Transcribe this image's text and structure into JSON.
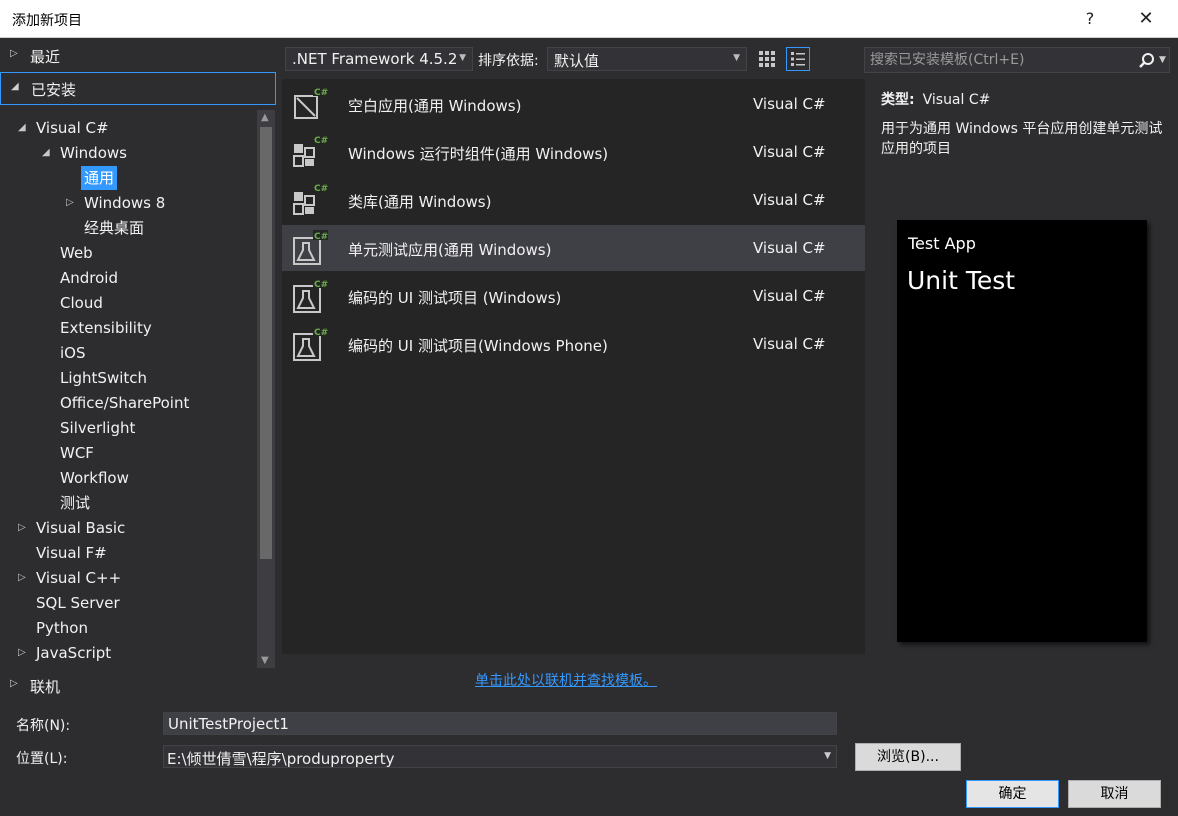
{
  "window": {
    "title": "添加新项目",
    "help": "?",
    "close": "✕"
  },
  "sections": {
    "recent": "最近",
    "installed": "已安装",
    "online": "联机"
  },
  "tree": [
    {
      "label": "Visual C#",
      "level": 0,
      "arrow": "down"
    },
    {
      "label": "Windows",
      "level": 1,
      "arrow": "down"
    },
    {
      "label": "通用",
      "level": 2,
      "arrow": "none",
      "selected": true
    },
    {
      "label": "Windows 8",
      "level": 2,
      "arrow": "right"
    },
    {
      "label": "经典桌面",
      "level": 2,
      "arrow": "none"
    },
    {
      "label": "Web",
      "level": 1,
      "arrow": "none"
    },
    {
      "label": "Android",
      "level": 1,
      "arrow": "none"
    },
    {
      "label": "Cloud",
      "level": 1,
      "arrow": "none"
    },
    {
      "label": "Extensibility",
      "level": 1,
      "arrow": "none"
    },
    {
      "label": "iOS",
      "level": 1,
      "arrow": "none"
    },
    {
      "label": "LightSwitch",
      "level": 1,
      "arrow": "none"
    },
    {
      "label": "Office/SharePoint",
      "level": 1,
      "arrow": "none"
    },
    {
      "label": "Silverlight",
      "level": 1,
      "arrow": "none"
    },
    {
      "label": "WCF",
      "level": 1,
      "arrow": "none"
    },
    {
      "label": "Workflow",
      "level": 1,
      "arrow": "none"
    },
    {
      "label": "测试",
      "level": 1,
      "arrow": "none"
    },
    {
      "label": "Visual Basic",
      "level": 0,
      "arrow": "right"
    },
    {
      "label": "Visual F#",
      "level": 0,
      "arrow": "none"
    },
    {
      "label": "Visual C++",
      "level": 0,
      "arrow": "right"
    },
    {
      "label": "SQL Server",
      "level": 0,
      "arrow": "none"
    },
    {
      "label": "Python",
      "level": 0,
      "arrow": "none"
    },
    {
      "label": "JavaScript",
      "level": 0,
      "arrow": "right"
    }
  ],
  "toolbar": {
    "framework": ".NET Framework 4.5.2",
    "sort_label": "排序依据:",
    "sort_value": "默认值"
  },
  "search": {
    "placeholder": "搜索已安装模板(Ctrl+E)"
  },
  "templates": [
    {
      "name": "空白应用(通用 Windows)",
      "lang": "Visual C#",
      "icon": "blank-app-icon",
      "selected": false
    },
    {
      "name": "Windows 运行时组件(通用 Windows)",
      "lang": "Visual C#",
      "icon": "runtime-component-icon",
      "selected": false
    },
    {
      "name": "类库(通用 Windows)",
      "lang": "Visual C#",
      "icon": "class-library-icon",
      "selected": false
    },
    {
      "name": "单元测试应用(通用 Windows)",
      "lang": "Visual C#",
      "icon": "unit-test-icon",
      "selected": true
    },
    {
      "name": "编码的 UI 测试项目 (Windows)",
      "lang": "Visual C#",
      "icon": "coded-ui-test-icon",
      "selected": false
    },
    {
      "name": "编码的 UI 测试项目(Windows Phone)",
      "lang": "Visual C#",
      "icon": "coded-ui-test-icon",
      "selected": false
    }
  ],
  "online_link": "单击此处以联机并查找模板。",
  "details": {
    "type_key": "类型:",
    "type_value": "Visual C#",
    "description": "用于为通用 Windows 平台应用创建单元测试应用的项目",
    "preview_app": "Test App",
    "preview_title": "Unit Test"
  },
  "form": {
    "name_label": "名称(N):",
    "name_value": "UnitTestProject1",
    "location_label": "位置(L):",
    "location_value": "E:\\倾世倩雪\\程序\\produproperty",
    "browse": "浏览(B)...",
    "ok": "确定",
    "cancel": "取消"
  },
  "colors": {
    "background": "#2d2d30",
    "list_background": "#252526",
    "accent": "#3399ff",
    "csharp_badge": "#68b04a"
  }
}
